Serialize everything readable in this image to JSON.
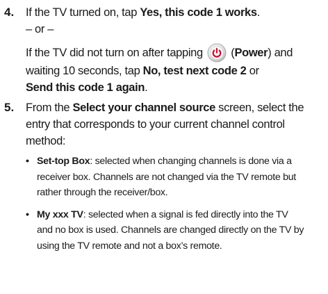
{
  "step4": {
    "number": "4.",
    "line1_pre": "If the TV turned on, tap ",
    "line1_bold": "Yes, this code 1 works",
    "line1_post": ".",
    "or_text": "– or –",
    "line3_pre": "If the TV did not turn on after tapping",
    "line3_paren_open": " (",
    "line3_bold": "Power",
    "line3_post": ") and",
    "line4_pre": "waiting 10 seconds, tap ",
    "line4_bold": "No, test next code 2",
    "line4_post": " or",
    "line5_bold": "Send this code 1 again",
    "line5_post": "."
  },
  "step5": {
    "number": "5.",
    "line1_pre": "From the ",
    "line1_bold": "Select your channel source",
    "line1_post": " screen, select the",
    "line2": "entry that corresponds to your current channel control",
    "line3": "method:",
    "bullets": [
      {
        "term": "Set-top Box",
        "line1_rest": ": selected when changing channels is done via a",
        "line2": "receiver box. Channels are not changed via the TV remote but",
        "line3": "rather through the receiver/box."
      },
      {
        "term": "My xxx TV",
        "line1_rest": ": selected when a signal is fed directly into the TV",
        "line2": "and no box is used. Channels are changed directly on the TV by",
        "line3": "using the TV remote and not a box’s remote."
      }
    ]
  },
  "colors": {
    "power_icon_outer": "#c8c8c8",
    "power_icon_inner": "#f2f2f2",
    "power_symbol": "#c8102e",
    "text": "#1a1a1a"
  },
  "icons": {
    "power": "power-icon"
  }
}
